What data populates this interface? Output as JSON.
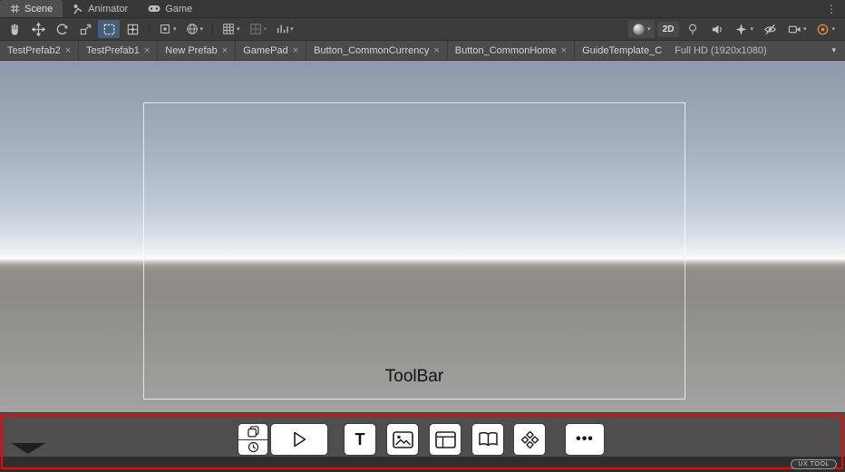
{
  "glyphs": {
    "dropdown": "▾",
    "close": "×",
    "overflow": "⋮",
    "dots": "•••"
  },
  "window_tabs": {
    "items": [
      {
        "label": "Scene",
        "active": true
      },
      {
        "label": "Animator",
        "active": false
      },
      {
        "label": "Game",
        "active": false
      }
    ]
  },
  "scene_toolbar": {
    "mode_2d": "2D",
    "tools": [
      "hand",
      "move",
      "rotate",
      "scale",
      "rect",
      "transform"
    ],
    "selected_tool": "rect"
  },
  "prefab_bar": {
    "tabs": [
      {
        "label": "TestPrefab2"
      },
      {
        "label": "TestPrefab1"
      },
      {
        "label": "New Prefab"
      },
      {
        "label": "GamePad"
      },
      {
        "label": "Button_CommonCurrency"
      },
      {
        "label": "Button_CommonHome"
      },
      {
        "label": "GuideTemplate_C"
      }
    ],
    "resolution": "Full HD (1920x1080)"
  },
  "scene_view": {
    "canvas_label": "ToolBar"
  },
  "ux_toolbar": {
    "text_tool_glyph": "T",
    "badge": "UX TOOL",
    "buttons": [
      "window-stack",
      "history",
      "play",
      "text",
      "image",
      "panel",
      "book",
      "pattern",
      "more"
    ]
  },
  "colors": {
    "annotation_red": "#ff0000",
    "tool_selected": "#46607c",
    "sky_top": "#8d99aa",
    "ground": "#8e8c88"
  }
}
